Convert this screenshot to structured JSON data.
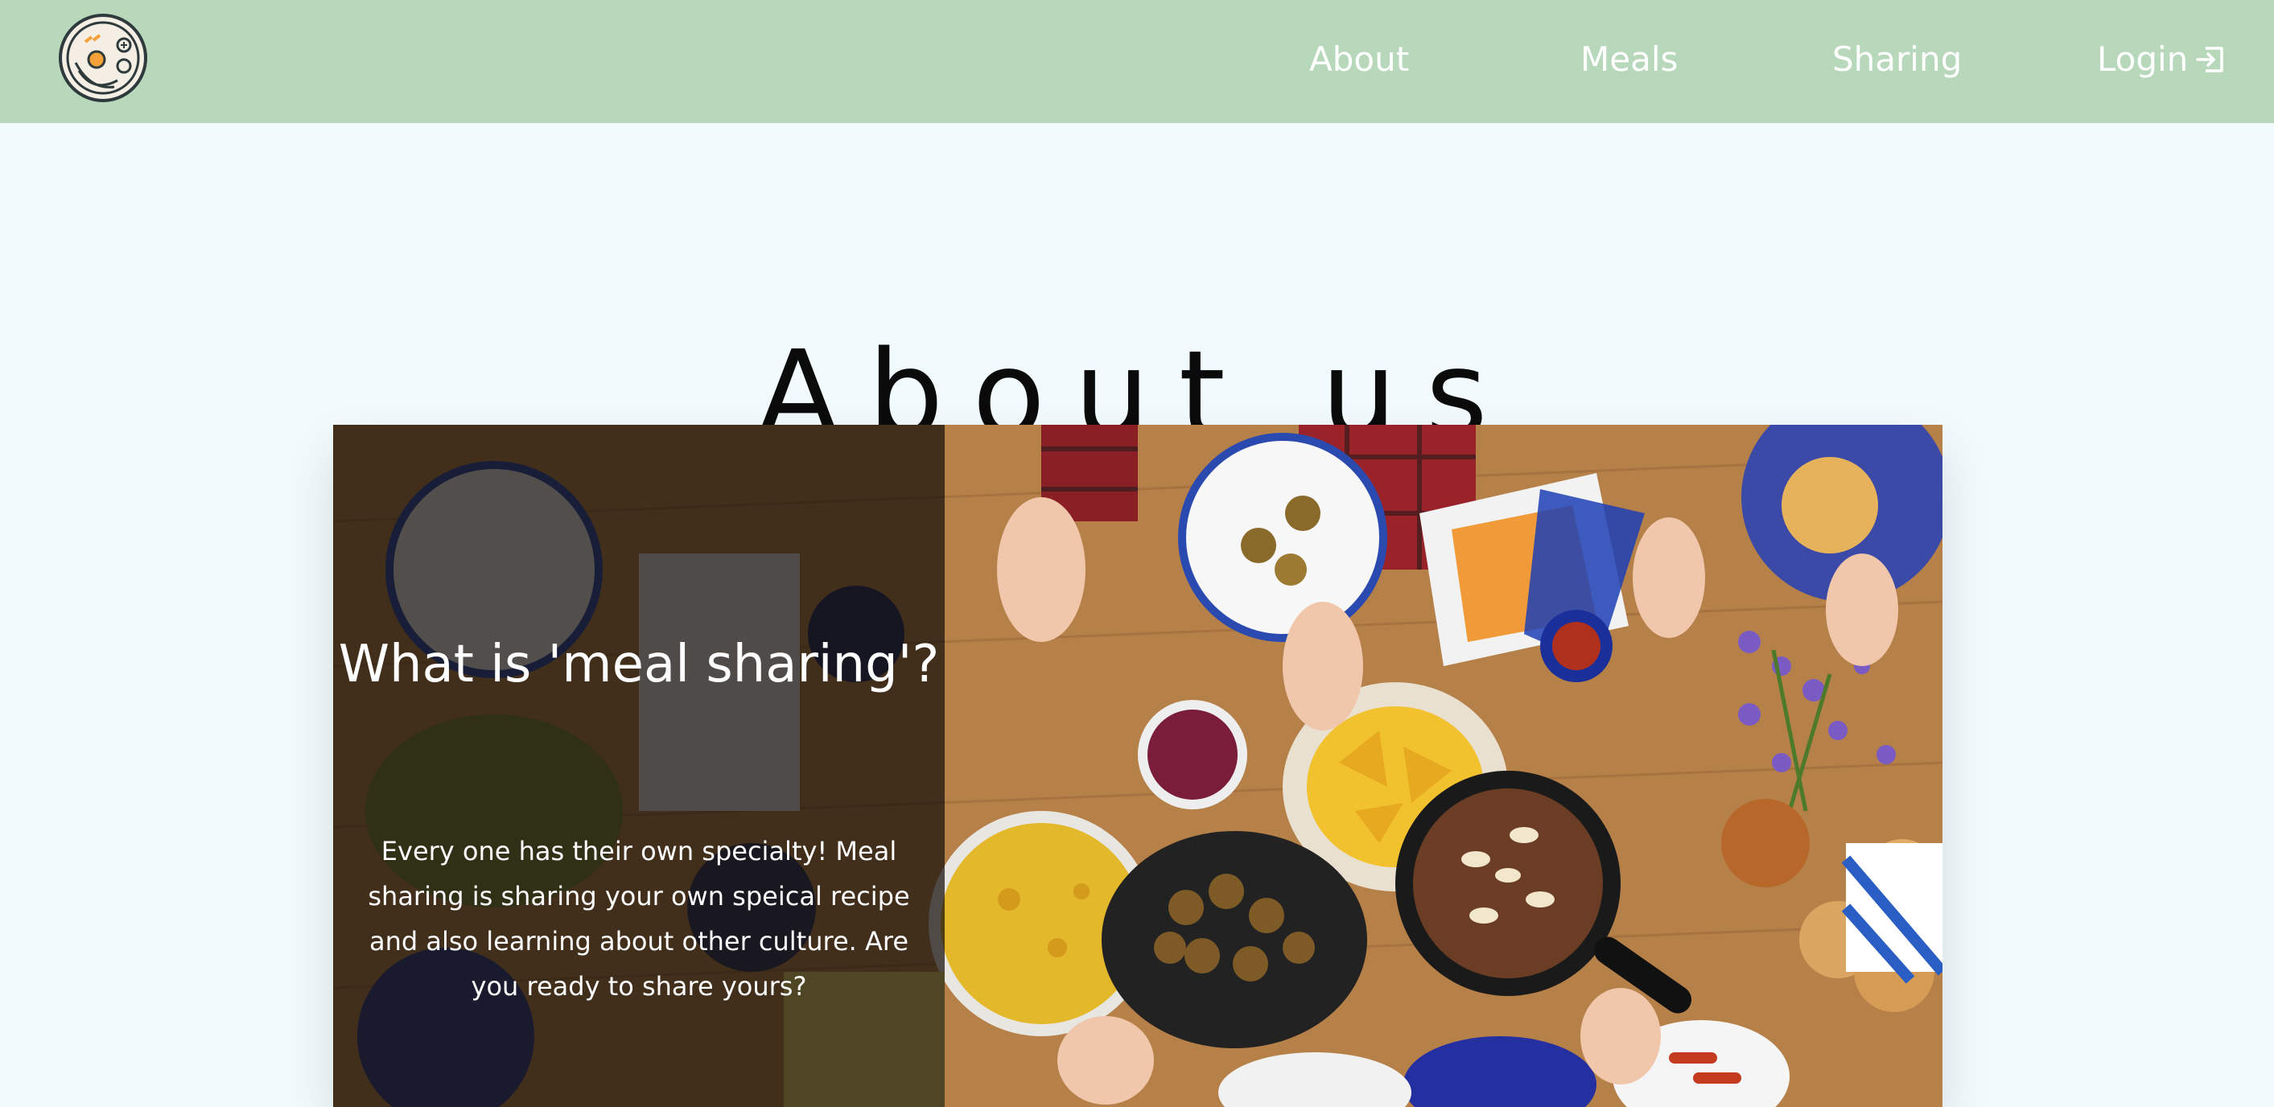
{
  "header": {
    "logo_icon": "food-bowl-logo-icon",
    "nav": {
      "about_label": "About",
      "meals_label": "Meals",
      "sharing_label": "Sharing",
      "login_label": "Login",
      "login_icon": "login-icon"
    }
  },
  "main": {
    "title": "About us",
    "hero": {
      "heading": "What is 'meal sharing'?",
      "text": "Every one has their own specialty! Meal sharing is sharing your own speical recipe and also learning about other culture. Are you ready to share yours?",
      "photo_icon": "food-table-photo"
    }
  },
  "colors": {
    "header_bg": "#b8d8bb",
    "page_bg": "#f1fbfe",
    "nav_text": "#ffffff",
    "overlay": "#140e0a"
  }
}
